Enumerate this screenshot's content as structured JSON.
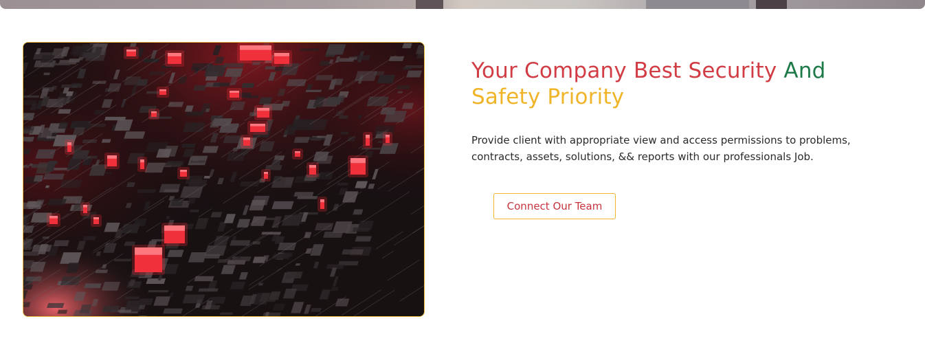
{
  "hero": {
    "image_icon": "circuit-city-image",
    "border_color": "#e8b93a"
  },
  "heading": {
    "part1": "Your Company Best Security ",
    "part2": "And",
    "part3": "Safety Priority",
    "colors": {
      "part1": "#d13c45",
      "part2": "#1f7a4a",
      "part3": "#f0b429"
    }
  },
  "description": "Provide client with appropriate view and access permissions to problems, contracts, assets, solutions, && reports with our professionals Job.",
  "cta": {
    "label": "Connect Our Team",
    "text_color": "#c8343d",
    "border_color": "#f0b429"
  }
}
